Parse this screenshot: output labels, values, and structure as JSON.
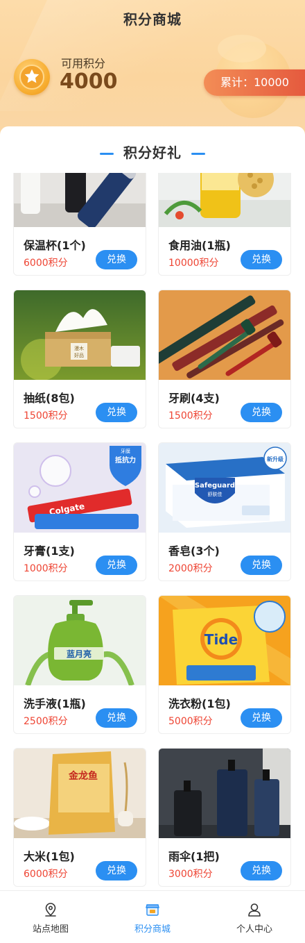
{
  "header": {
    "title": "积分商城",
    "points_label": "可用积分",
    "points_value": "4000",
    "total_label": "累计：10000"
  },
  "section": {
    "title": "积分好礼"
  },
  "products": [
    {
      "name": "保温杯(1个)",
      "price": "6000积分",
      "button": "兑换",
      "image": "thermos-cup-photo"
    },
    {
      "name": "食用油(1瓶)",
      "price": "10000积分",
      "button": "兑换",
      "image": "cooking-oil-photo"
    },
    {
      "name": "抽纸(8包)",
      "price": "1500积分",
      "button": "兑换",
      "image": "tissue-photo"
    },
    {
      "name": "牙刷(4支)",
      "price": "1500积分",
      "button": "兑换",
      "image": "toothbrush-photo"
    },
    {
      "name": "牙膏(1支)",
      "price": "1000积分",
      "button": "兑换",
      "image": "toothpaste-photo"
    },
    {
      "name": "香皂(3个)",
      "price": "2000积分",
      "button": "兑换",
      "image": "soap-photo"
    },
    {
      "name": "洗手液(1瓶)",
      "price": "2500积分",
      "button": "兑换",
      "image": "hand-wash-photo"
    },
    {
      "name": "洗衣粉(1包)",
      "price": "5000积分",
      "button": "兑换",
      "image": "detergent-photo"
    },
    {
      "name": "大米(1包)",
      "price": "6000积分",
      "button": "兑换",
      "image": "rice-photo"
    },
    {
      "name": "雨伞(1把)",
      "price": "3000积分",
      "button": "兑换",
      "image": "umbrella-photo"
    }
  ],
  "image_text": {
    "tissue_brand": "漫木",
    "tissue_brand2": "好品",
    "toothpaste_badge1": "牙膜",
    "toothpaste_badge2": "抵抗力",
    "toothpaste_brand": "Colgate",
    "soap_brand": "Safeguard",
    "soap_brand_cn": "舒肤佳",
    "soap_badge": "新升级",
    "handwash_brand": "蓝月亮",
    "detergent_brand": "Tide",
    "rice_brand": "金龙鱼"
  },
  "tabbar": {
    "items": [
      {
        "label": "站点地图",
        "icon": "map-pin-icon",
        "active": false
      },
      {
        "label": "积分商城",
        "icon": "shop-icon",
        "active": true
      },
      {
        "label": "个人中心",
        "icon": "user-icon",
        "active": false
      }
    ]
  },
  "colors": {
    "accent": "#2b8ff2",
    "price": "#ee4433",
    "header_bg": "#fbd59e",
    "total_pill": "#e55a3e"
  }
}
